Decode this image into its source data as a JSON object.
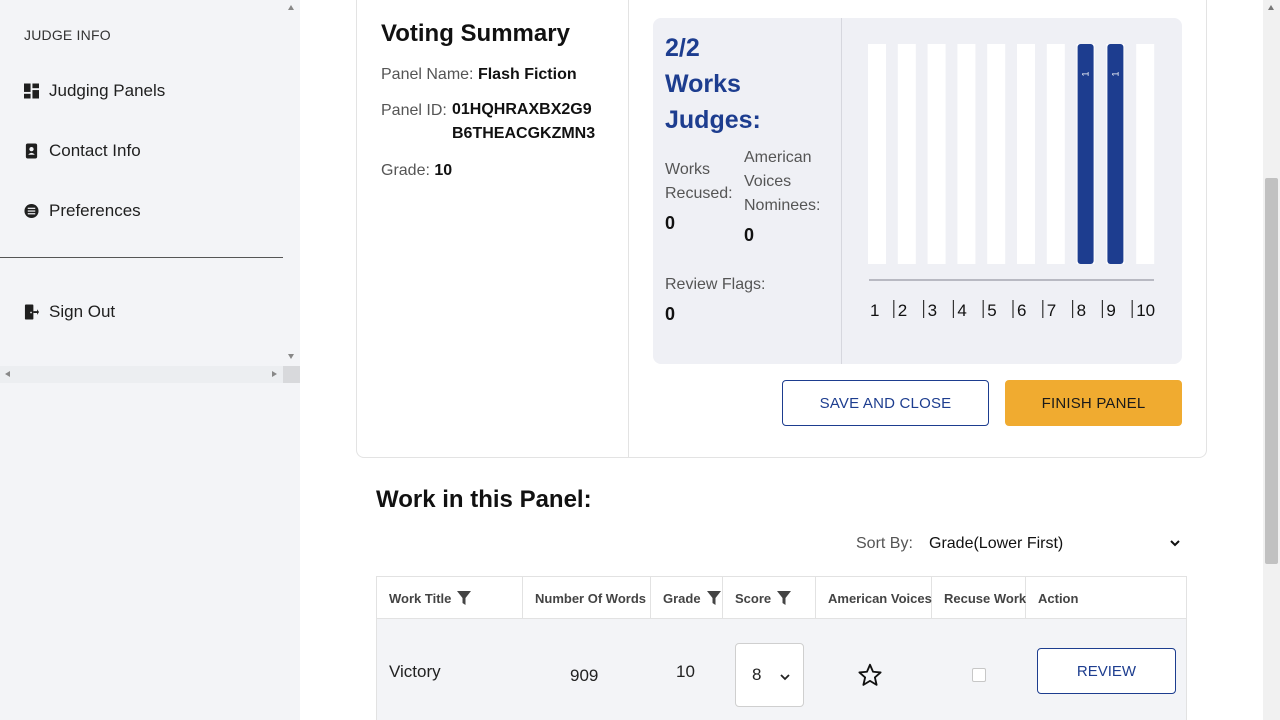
{
  "sidebar": {
    "heading": "JUDGE INFO",
    "items": [
      {
        "label": "Judging Panels",
        "icon": "dashboard-icon"
      },
      {
        "label": "Contact Info",
        "icon": "contact-book-icon"
      },
      {
        "label": "Preferences",
        "icon": "settings-gear-icon"
      }
    ],
    "sign_out": {
      "label": "Sign Out",
      "icon": "sign-out-icon"
    }
  },
  "summary": {
    "title": "Voting Summary",
    "panel_name_label": "Panel Name:",
    "panel_name": "Flash Fiction",
    "panel_id_label": "Panel ID:",
    "panel_id": "01HQHRAXBX2G9 B6THEACGKZMN3",
    "grade_label": "Grade:",
    "grade": "10"
  },
  "stats": {
    "works_count": "2/2",
    "works_judges_label": "Works Judges:",
    "works_recused_label": "Works Recused:",
    "works_recused": "0",
    "american_voices_label": "American Voices Nominees:",
    "american_voices": "0",
    "review_flags_label": "Review Flags:",
    "review_flags": "0"
  },
  "chart_data": {
    "type": "bar",
    "categories": [
      "1",
      "2",
      "3",
      "4",
      "5",
      "6",
      "7",
      "8",
      "9",
      "10"
    ],
    "values": [
      0,
      0,
      0,
      0,
      0,
      0,
      0,
      1,
      1,
      0
    ],
    "ylim": [
      0,
      1
    ],
    "bar_color": "#1d3d8f",
    "track_color": "#ffffff"
  },
  "buttons": {
    "save_close": "SAVE AND CLOSE",
    "finish_panel": "FINISH PANEL"
  },
  "work": {
    "title": "Work in this Panel:",
    "sort_label": "Sort By:",
    "sort_value": "Grade(Lower First)",
    "columns": [
      "Work Title",
      "Number Of Words",
      "Grade",
      "Score",
      "American Voices",
      "Recuse Work",
      "Action"
    ],
    "rows": [
      {
        "title": "Victory",
        "words": "909",
        "grade": "10",
        "score": "8",
        "review_label": "REVIEW"
      }
    ]
  },
  "colors": {
    "accent": "#1d3d8f",
    "primary_button": "#f0ab30",
    "panel_bg": "#eff0f5",
    "sidebar_bg": "#f3f4f7"
  }
}
